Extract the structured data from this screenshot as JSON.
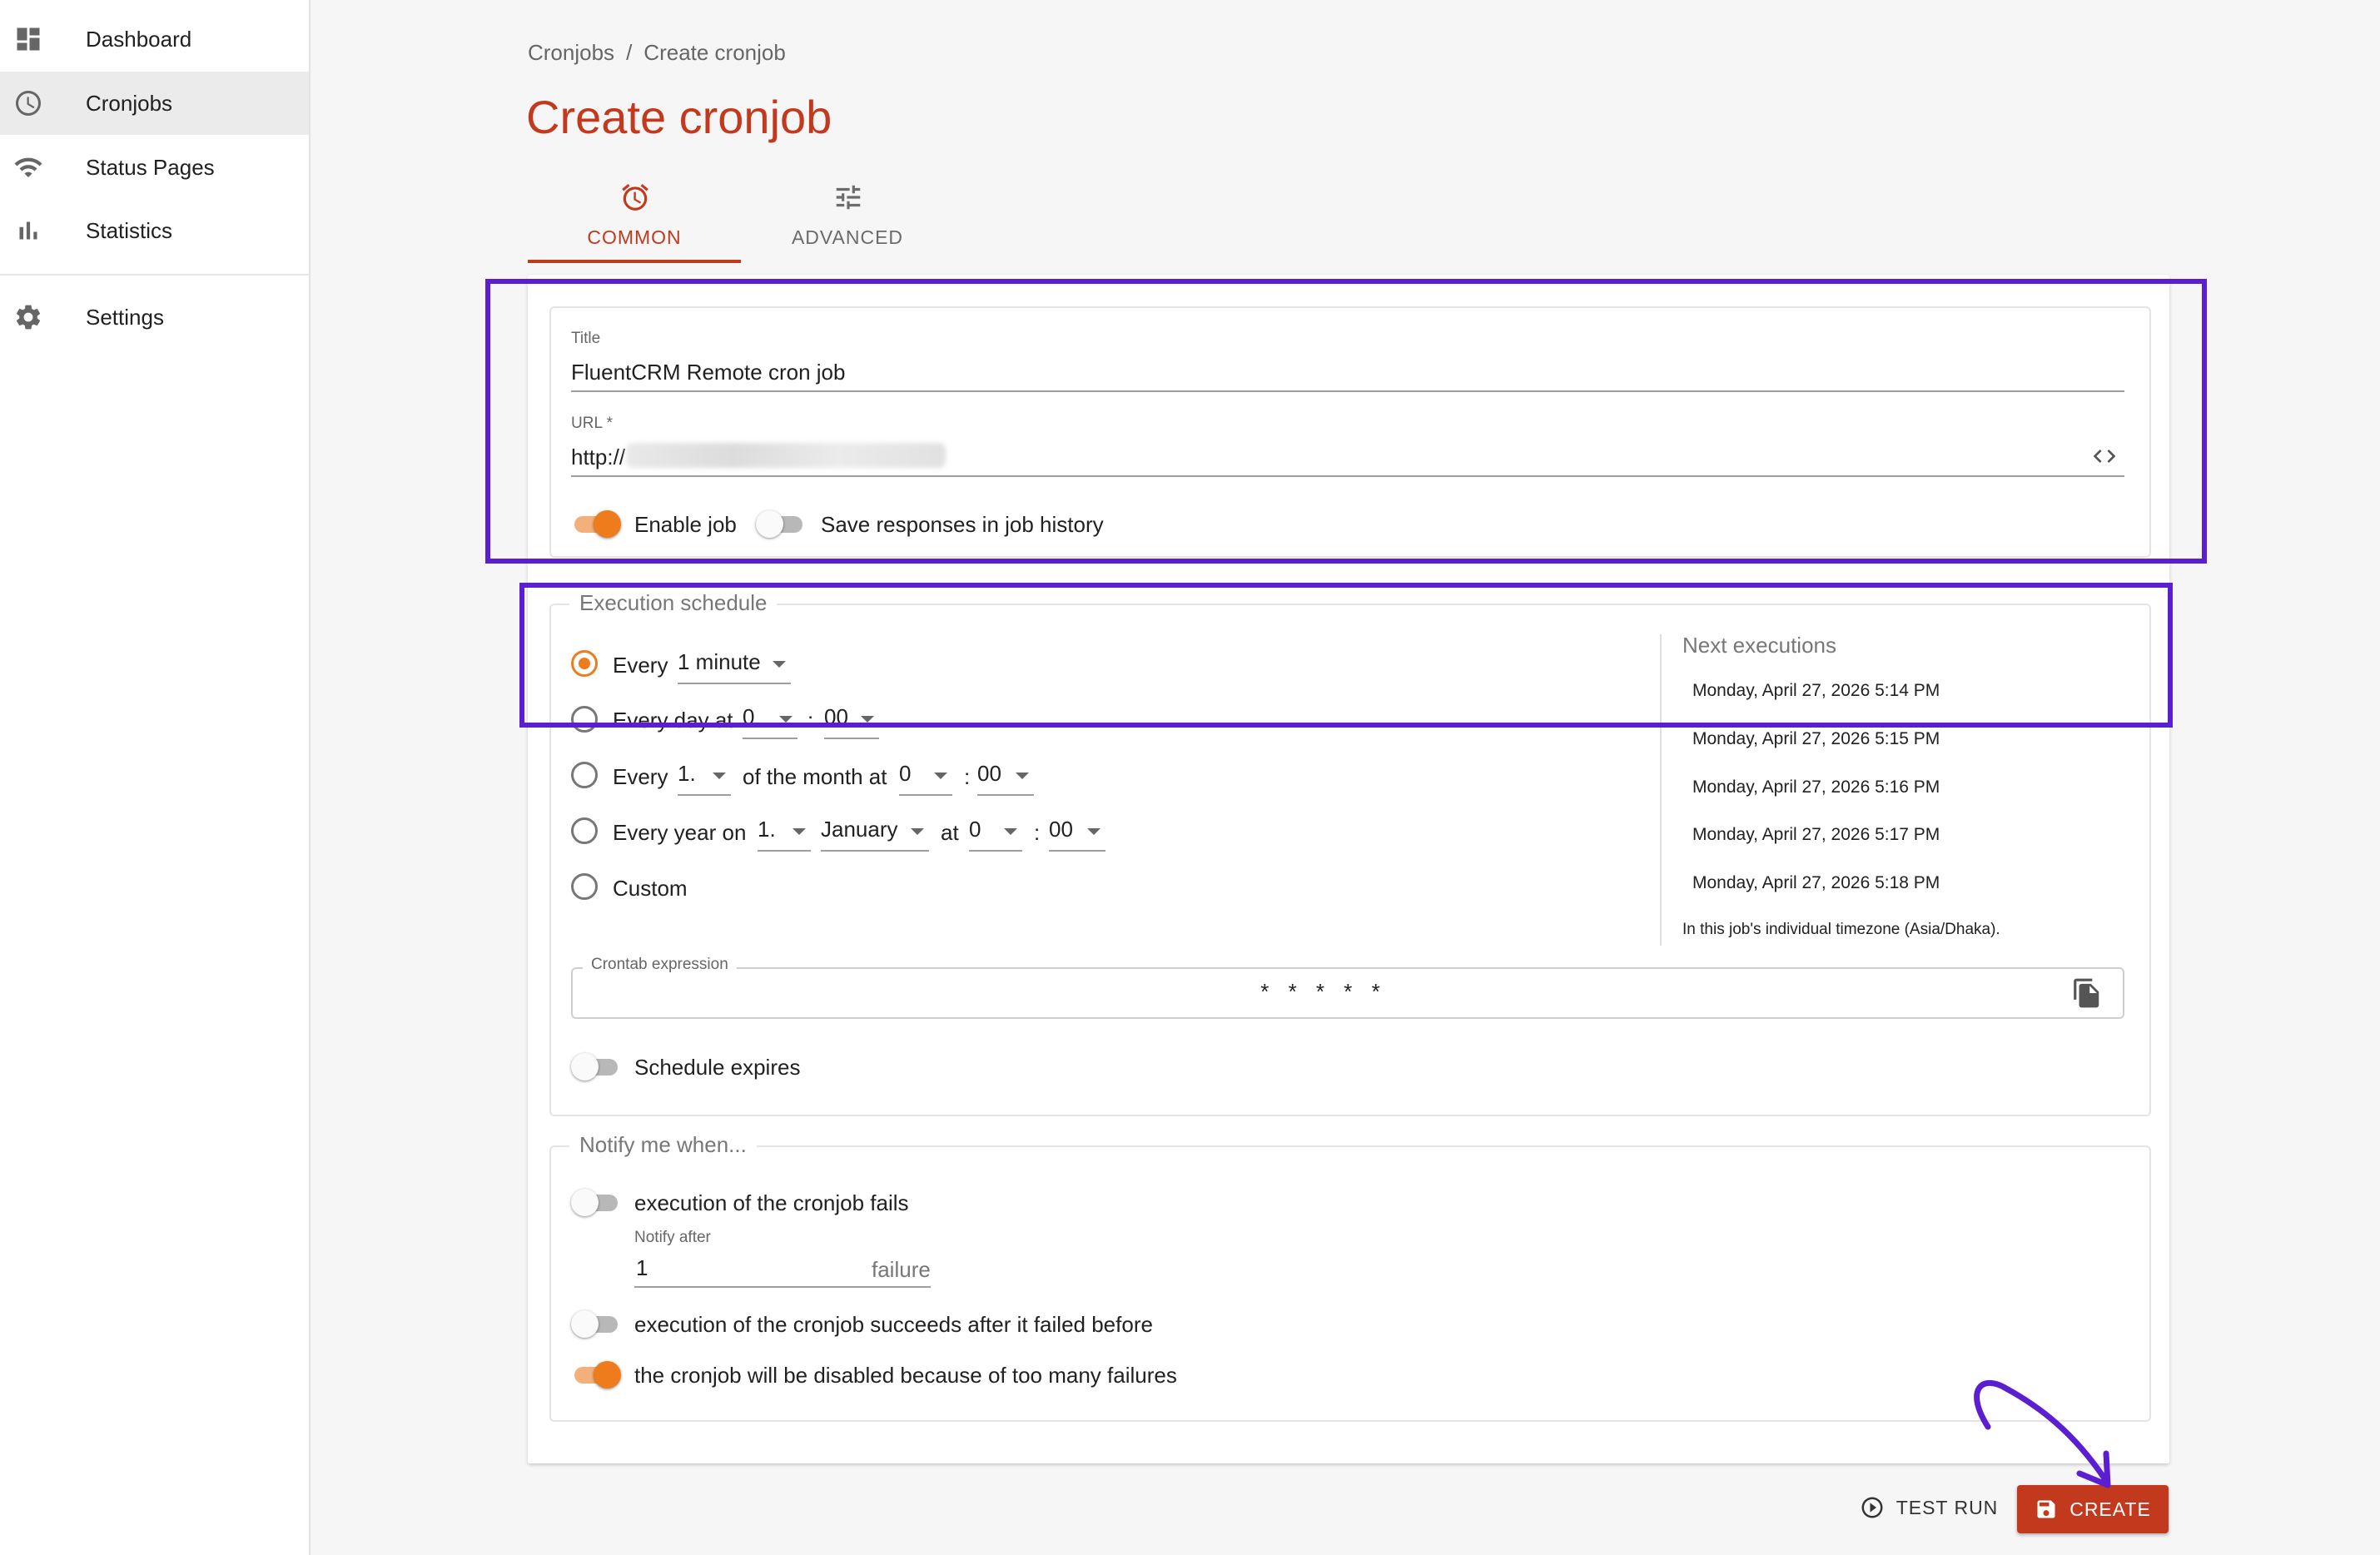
{
  "sidebar": {
    "items": [
      {
        "label": "Dashboard",
        "icon": "dashboard-icon"
      },
      {
        "label": "Cronjobs",
        "icon": "clock-icon",
        "active": true
      },
      {
        "label": "Status Pages",
        "icon": "wifi-broadcast-icon"
      },
      {
        "label": "Statistics",
        "icon": "bar-chart-icon"
      },
      {
        "label": "Settings",
        "icon": "gear-icon"
      }
    ]
  },
  "breadcrumb": {
    "parent": "Cronjobs",
    "separator": "/",
    "current": "Create cronjob"
  },
  "page_title": "Create cronjob",
  "tabs": [
    {
      "label": "COMMON",
      "icon": "alarm-clock-icon",
      "active": true
    },
    {
      "label": "ADVANCED",
      "icon": "tune-sliders-icon",
      "active": false
    }
  ],
  "form": {
    "title_label": "Title",
    "title_value": "FluentCRM Remote cron job",
    "url_label": "URL *",
    "url_value": "http://",
    "enable_job_label": "Enable job",
    "enable_job": true,
    "save_responses_label": "Save responses in job history",
    "save_responses": false
  },
  "schedule": {
    "legend": "Execution schedule",
    "opt1": {
      "every": "Every",
      "interval": "1 minute"
    },
    "opt2": {
      "text": "Every day at",
      "hour": "0",
      "colon": ":",
      "minute": "00"
    },
    "opt3": {
      "every": "Every",
      "day": "1.",
      "of_month": "of the month at",
      "hour": "0",
      "colon": ":",
      "minute": "00"
    },
    "opt4": {
      "text": "Every year on",
      "day": "1.",
      "month": "January",
      "at": "at",
      "hour": "0",
      "colon": ":",
      "minute": "00"
    },
    "opt5": {
      "text": "Custom"
    },
    "selected": "opt1",
    "crontab_label": "Crontab expression",
    "crontab_value": "* * * * *",
    "expires_label": "Schedule expires",
    "expires": false
  },
  "next_executions": {
    "title": "Next executions",
    "items": [
      "Monday, April 27, 2026 5:14 PM",
      "Monday, April 27, 2026 5:15 PM",
      "Monday, April 27, 2026 5:16 PM",
      "Monday, April 27, 2026 5:17 PM",
      "Monday, April 27, 2026 5:18 PM"
    ],
    "timezone_note": "In this job's individual timezone (Asia/Dhaka)."
  },
  "notify": {
    "legend": "Notify me when...",
    "fails_label": "execution of the cronjob fails",
    "fails": false,
    "notify_after_label": "Notify after",
    "notify_after_value": "1",
    "notify_after_unit": "failure",
    "succeeds_label": "execution of the cronjob succeeds after it failed before",
    "succeeds": false,
    "disabled_label": "the cronjob will be disabled because of too many failures",
    "disabled": true
  },
  "actions": {
    "test_run": "TEST RUN",
    "create": "CREATE"
  },
  "colors": {
    "accent": "#c3391d",
    "toggle": "#ef7c1c",
    "annotation": "#5b1fd1"
  }
}
